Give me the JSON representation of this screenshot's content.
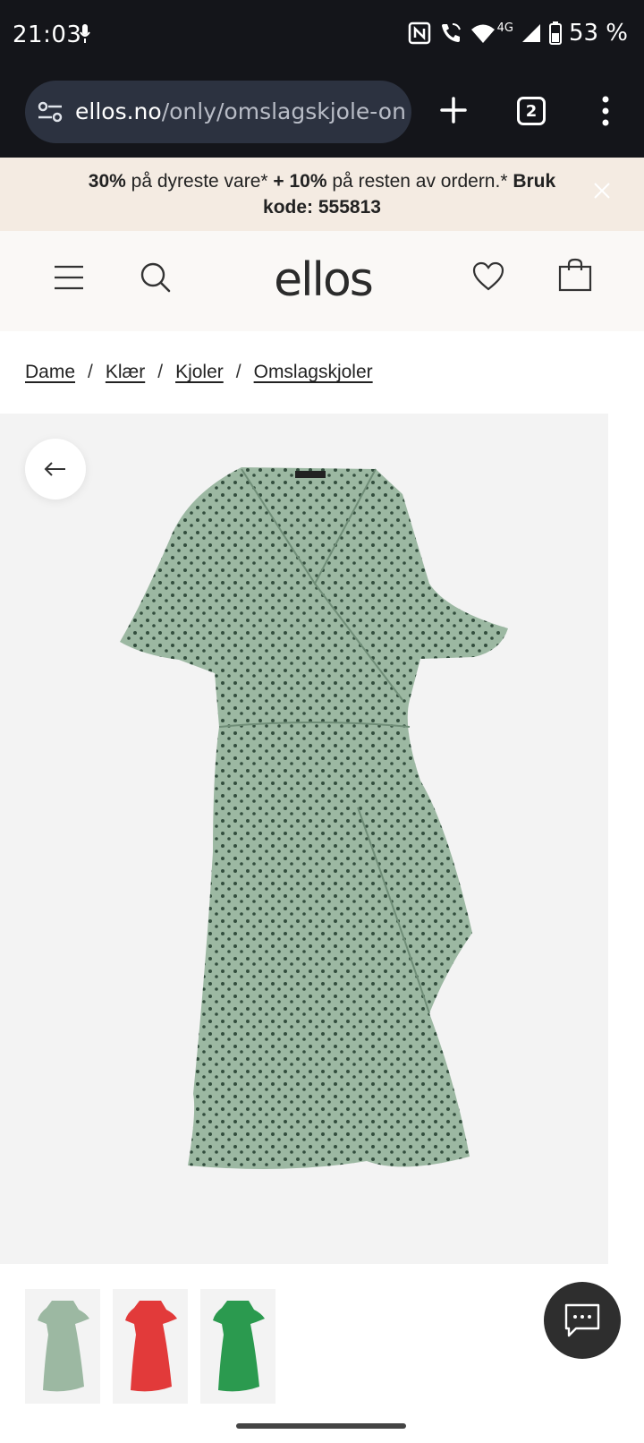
{
  "status_bar": {
    "time": "21:03",
    "network": "4G",
    "battery": "53 %",
    "icons": [
      "mic-icon",
      "nfc-icon",
      "wifi-call-icon",
      "wifi-icon",
      "signal-icon",
      "battery-icon"
    ]
  },
  "browser": {
    "url_domain": "ellos.no",
    "url_path": "/only/omslagskjole-on",
    "tab_count": "2",
    "icons": [
      "site-settings-icon",
      "new-tab-icon",
      "tabs-icon",
      "more-menu-icon"
    ]
  },
  "promo": {
    "part1_bold": "30%",
    "part2": " på dyreste vare* ",
    "part3_bold": "+ 10%",
    "part4": " på resten av ordern.* ",
    "part5_bold": "Bruk kode: 555813"
  },
  "header": {
    "logo": "ellos",
    "icons": [
      "menu-icon",
      "search-icon",
      "heart-icon",
      "bag-icon"
    ]
  },
  "breadcrumb": {
    "items": [
      "Dame",
      "Klær",
      "Kjoler",
      "Omslagskjoler"
    ],
    "separator": "/"
  },
  "product": {
    "main_color": "#9cb8a2",
    "thumbnails": [
      {
        "color": "#9cb8a2"
      },
      {
        "color": "#e23a3a"
      },
      {
        "color": "#2b9a4f"
      }
    ]
  },
  "colors": {
    "status_bg": "#14151a",
    "urlbar_bg": "#2c3240",
    "promo_bg": "#f4ebe2",
    "header_bg": "#faf8f6",
    "product_bg": "#f3f3f3",
    "chat_bg": "#2e2e2e"
  }
}
